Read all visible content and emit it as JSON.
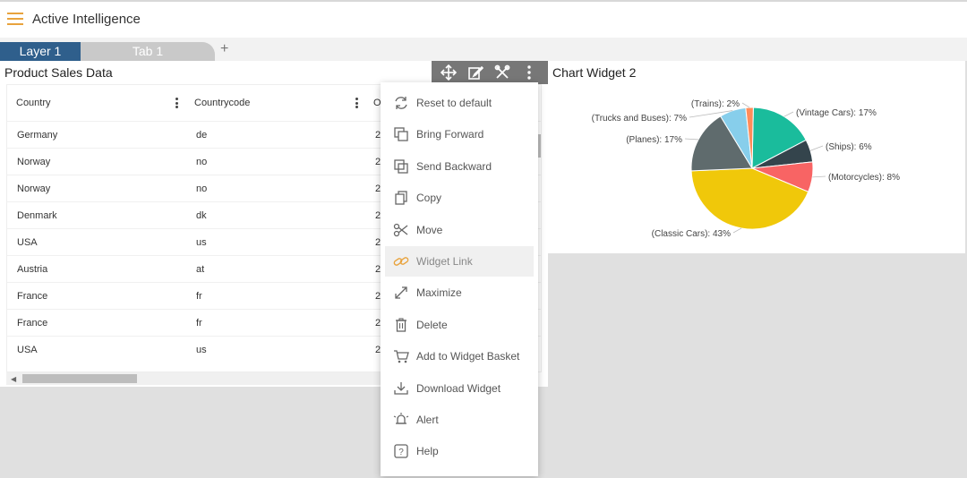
{
  "app": {
    "title": "Active Intelligence"
  },
  "tabs": {
    "layer": "Layer 1",
    "tab": "Tab 1",
    "add": "+"
  },
  "widget1": {
    "title": "Product Sales Data",
    "columns": [
      "Country",
      "Countrycode",
      "O"
    ],
    "rows": [
      [
        "Germany",
        "de",
        "2"
      ],
      [
        "Norway",
        "no",
        "2"
      ],
      [
        "Norway",
        "no",
        "2"
      ],
      [
        "Denmark",
        "dk",
        "2"
      ],
      [
        "USA",
        "us",
        "2"
      ],
      [
        "Austria",
        "at",
        "2"
      ],
      [
        "France",
        "fr",
        "2"
      ],
      [
        "France",
        "fr",
        "2"
      ],
      [
        "USA",
        "us",
        "2"
      ]
    ]
  },
  "widget2": {
    "title": "Chart Widget 2"
  },
  "menu": {
    "items": [
      {
        "label": "Reset to default",
        "icon": "refresh-icon"
      },
      {
        "label": "Bring Forward",
        "icon": "bring-forward-icon"
      },
      {
        "label": "Send Backward",
        "icon": "send-backward-icon"
      },
      {
        "label": "Copy",
        "icon": "copy-icon"
      },
      {
        "label": "Move",
        "icon": "scissors-icon"
      },
      {
        "label": "Widget Link",
        "icon": "link-icon"
      },
      {
        "label": "Maximize",
        "icon": "maximize-icon"
      },
      {
        "label": "Delete",
        "icon": "trash-icon"
      },
      {
        "label": "Add to Widget Basket",
        "icon": "cart-icon"
      },
      {
        "label": "Download Widget",
        "icon": "download-icon"
      },
      {
        "label": "Alert",
        "icon": "bell-icon"
      },
      {
        "label": "Help",
        "icon": "help-icon"
      }
    ],
    "active_index": 5
  },
  "colors": {
    "accent": "#e8a33d",
    "layer_tab": "#2f5f8c",
    "toolbar": "#777777"
  },
  "chart_data": {
    "type": "pie",
    "slices": [
      {
        "label": "(Vintage Cars): 17%",
        "value": 17,
        "color": "#1abc9c"
      },
      {
        "label": "(Ships): 6%",
        "value": 6,
        "color": "#34444c"
      },
      {
        "label": "(Motorcycles): 8%",
        "value": 8,
        "color": "#f86464"
      },
      {
        "label": "(Classic Cars): 43%",
        "value": 43,
        "color": "#f0c80a"
      },
      {
        "label": "(Planes): 17%",
        "value": 17,
        "color": "#5f6b6d"
      },
      {
        "label": "(Trucks and Buses): 7%",
        "value": 7,
        "color": "#87ceeb"
      },
      {
        "label": "(Trains): 2%",
        "value": 2,
        "color": "#ff8c5a"
      }
    ]
  }
}
